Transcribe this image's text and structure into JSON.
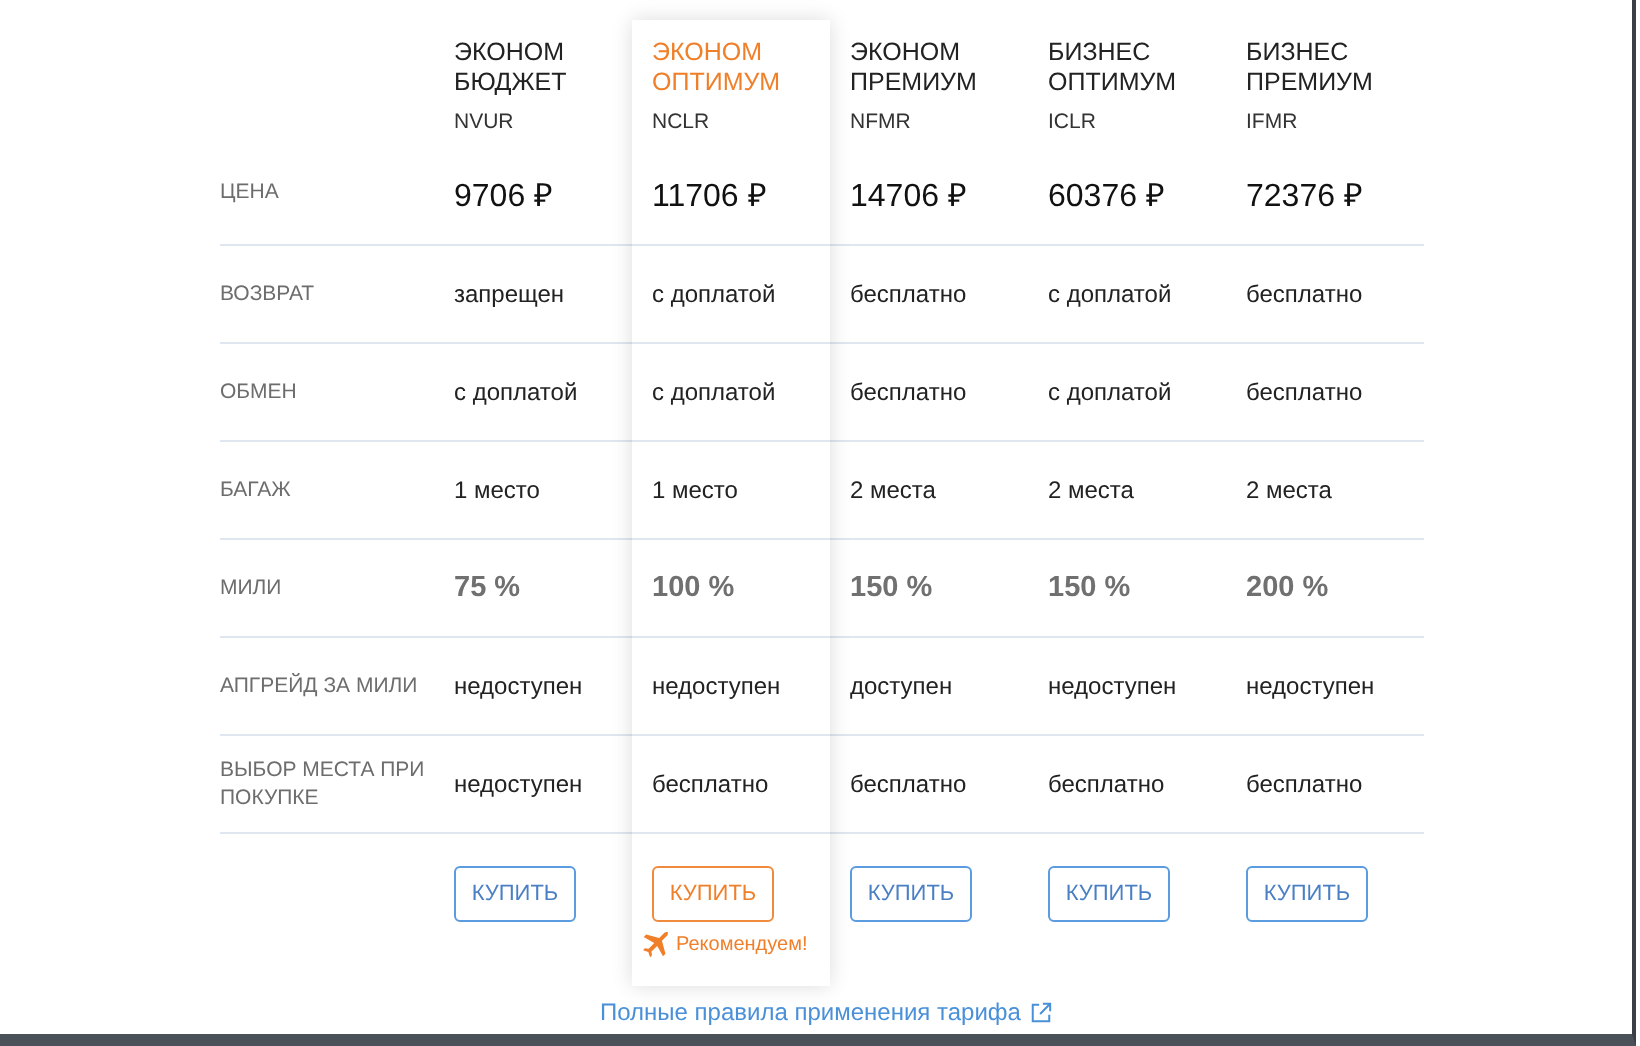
{
  "price_label": "ЦЕНА",
  "tariffs": [
    {
      "name": "ЭКОНОМ БЮДЖЕТ",
      "code": "NVUR",
      "price": "9706 ₽",
      "recommended": false,
      "buy": "КУПИТЬ"
    },
    {
      "name": "ЭКОНОМ ОПТИМУМ",
      "code": "NCLR",
      "price": "11706 ₽",
      "recommended": true,
      "buy": "КУПИТЬ",
      "badge": "Рекомендуем!"
    },
    {
      "name": "ЭКОНОМ ПРЕМИУМ",
      "code": "NFMR",
      "price": "14706 ₽",
      "recommended": false,
      "buy": "КУПИТЬ"
    },
    {
      "name": "БИЗНЕС ОПТИМУМ",
      "code": "ICLR",
      "price": "60376 ₽",
      "recommended": false,
      "buy": "КУПИТЬ"
    },
    {
      "name": "БИЗНЕС ПРЕМИУМ",
      "code": "IFMR",
      "price": "72376 ₽",
      "recommended": false,
      "buy": "КУПИТЬ"
    }
  ],
  "rows": [
    {
      "label": "ВОЗВРАТ",
      "kind": "text",
      "values": [
        "запрещен",
        "с доплатой",
        "бесплатно",
        "с доплатой",
        "бесплатно"
      ]
    },
    {
      "label": "ОБМЕН",
      "kind": "text",
      "values": [
        "с доплатой",
        "с доплатой",
        "бесплатно",
        "с доплатой",
        "бесплатно"
      ]
    },
    {
      "label": "БАГАЖ",
      "kind": "text",
      "values": [
        "1 место",
        "1 место",
        "2 места",
        "2 места",
        "2 места"
      ]
    },
    {
      "label": "МИЛИ",
      "kind": "percent",
      "values": [
        "75 %",
        "100 %",
        "150 %",
        "150 %",
        "200 %"
      ]
    },
    {
      "label": "АПГРЕЙД ЗА МИЛИ",
      "kind": "text",
      "values": [
        "недоступен",
        "недоступен",
        "доступен",
        "недоступен",
        "недоступен"
      ]
    },
    {
      "label": "ВЫБОР МЕСТА ПРИ ПОКУПКЕ",
      "kind": "text",
      "values": [
        "недоступен",
        "бесплатно",
        "бесплатно",
        "бесплатно",
        "бесплатно"
      ]
    }
  ],
  "rules_link": "Полные правила применения тарифа"
}
